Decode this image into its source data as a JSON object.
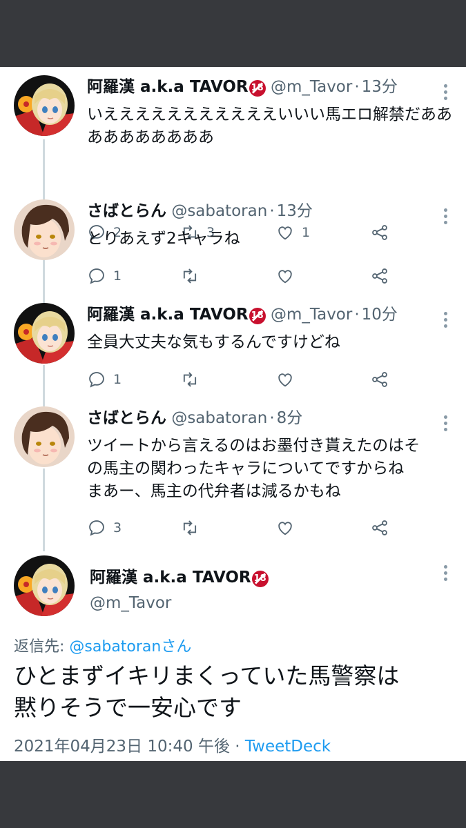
{
  "tweets": [
    {
      "name": "阿羅漢 a.k.a TAVOR",
      "badge": "18",
      "handle": "@m_Tavor",
      "separator": "·",
      "time": "13分",
      "text": "いえええええええええええいいい馬エロ解禁だああああああああああ",
      "replies": "2",
      "retweets": "3",
      "likes": "1",
      "avatar": "blonde-character-avatar"
    },
    {
      "name": "さばとらん",
      "handle": "@sabatoran",
      "separator": "·",
      "time": "13分",
      "text": "とりあえず2キャラね",
      "replies": "1",
      "retweets": "",
      "likes": "",
      "avatar": "brown-hair-character-avatar"
    },
    {
      "name": "阿羅漢 a.k.a TAVOR",
      "badge": "18",
      "handle": "@m_Tavor",
      "separator": "·",
      "time": "10分",
      "text": "全員大丈夫な気もするんですけどね",
      "replies": "1",
      "retweets": "",
      "likes": "",
      "avatar": "blonde-character-avatar"
    },
    {
      "name": "さばとらん",
      "handle": "@sabatoran",
      "separator": "·",
      "time": "8分",
      "text_lines": [
        "ツイートから言えるのはお墨付き貰えたのはそ",
        "の馬主の関わったキャラについてですからね",
        "まあー、馬主の代弁者は減るかもね"
      ],
      "replies": "3",
      "retweets": "",
      "likes": "",
      "avatar": "brown-hair-character-avatar"
    }
  ],
  "focal": {
    "name": "阿羅漢 a.k.a TAVOR",
    "badge": "18",
    "handle": "@m_Tavor",
    "reply_prefix": "返信先: ",
    "reply_handle": "@sabatoranさん",
    "text_lines": [
      "ひとまずイキリまくっていた馬警察は",
      "黙りそうで一安心です"
    ],
    "timestamp": "2021年04月23日 10:40 午後",
    "separator": " · ",
    "source": "TweetDeck"
  },
  "colors": {
    "background": "#37393d",
    "card": "#ffffff",
    "link": "#1d9bf0",
    "secondary_text": "#536471",
    "thread_line": "#cfd9de",
    "badge": "#c8102e"
  }
}
